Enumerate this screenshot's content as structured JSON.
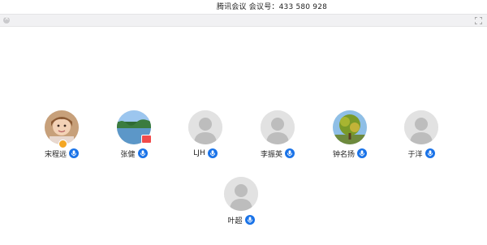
{
  "window": {
    "title": "腾讯会议 会议号：433 580 928"
  },
  "toolbar": {
    "close_icon": "close-icon",
    "fullscreen_icon": "fullscreen-icon"
  },
  "participants": [
    {
      "name": "宋程远",
      "avatar": "photo-child",
      "badge": "host",
      "mic": "on"
    },
    {
      "name": "张健",
      "avatar": "photo-lake",
      "badge": "share",
      "mic": "on"
    },
    {
      "name": "LJH",
      "avatar": "default",
      "badge": "",
      "mic": "on"
    },
    {
      "name": "李振英",
      "avatar": "default",
      "badge": "",
      "mic": "on"
    },
    {
      "name": "钟名扬",
      "avatar": "photo-tree",
      "badge": "",
      "mic": "on"
    },
    {
      "name": "于洋",
      "avatar": "default",
      "badge": "",
      "mic": "on"
    },
    {
      "name": "叶超",
      "avatar": "default",
      "badge": "",
      "mic": "on"
    }
  ],
  "colors": {
    "mic_accent": "#1a73e8",
    "host_badge": "#f4a623",
    "share_badge": "#f04b4b"
  }
}
